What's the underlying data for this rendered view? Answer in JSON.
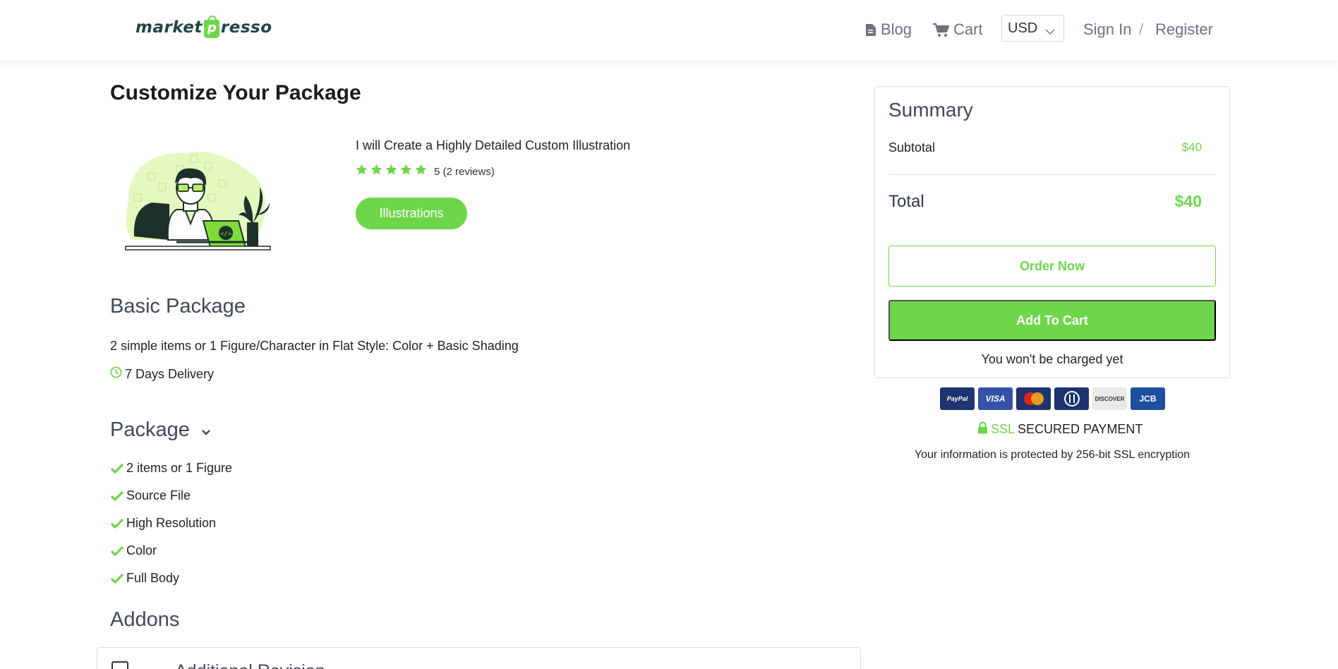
{
  "header": {
    "logo_text_a": "market",
    "logo_text_b": "resso",
    "logo_bag_letter": "p",
    "nav": {
      "blog": "Blog",
      "cart": "Cart",
      "currency": "USD",
      "sign_in": "Sign In",
      "separator": "/",
      "register": "Register"
    }
  },
  "main": {
    "page_title": "Customize Your Package",
    "gig": {
      "title": "I will Create a Highly Detailed Custom Illustration",
      "rating_text": "5 (2 reviews)",
      "rating_value": 5,
      "category": "Illustrations"
    },
    "package": {
      "name": "Basic Package",
      "description": "2 simple items or 1 Figure/Character in Flat Style: Color + Basic Shading",
      "delivery": "7 Days Delivery",
      "section_label": "Package",
      "features": [
        "2 items or 1 Figure",
        "Source File",
        "High Resolution",
        "Color",
        "Full Body"
      ]
    },
    "addons": {
      "label": "Addons",
      "items": [
        {
          "name": "Additional Revision"
        }
      ]
    }
  },
  "summary": {
    "title": "Summary",
    "subtotal_label": "Subtotal",
    "subtotal_value": "$40",
    "total_label": "Total",
    "total_value": "$40",
    "order_now": "Order Now",
    "add_to_cart": "Add To Cart",
    "note": "You won't be charged yet",
    "payment_cards": [
      "PayPal",
      "VISA",
      "MasterCard",
      "Diners",
      "DISCOVER",
      "JCB"
    ],
    "ssl_label": "SSL",
    "secured_label": "SECURED PAYMENT",
    "ssl_note": "Your information is protected by 256-bit SSL encryption"
  },
  "colors": {
    "accent": "#6ed64a",
    "heading": "#3e4a56",
    "border": "#dcdfe3"
  }
}
